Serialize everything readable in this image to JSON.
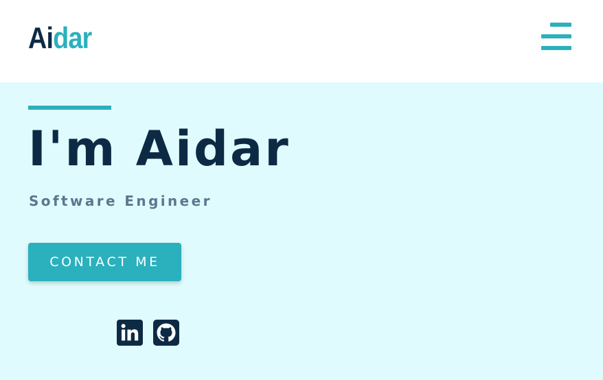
{
  "header": {
    "logo_dark": "Ai",
    "logo_accent": "dar",
    "menu_icon": "hamburger-menu-icon"
  },
  "hero": {
    "title": "I'm Aidar",
    "subtitle": "Software Engineer",
    "contact_label": "CONTACT ME"
  },
  "social": [
    {
      "icon": "linkedin-icon"
    },
    {
      "icon": "github-icon"
    }
  ],
  "colors": {
    "accent": "#2bb0bd",
    "dark": "#0d2a45",
    "muted": "#5b7790",
    "hero_background": "#e0fbfd",
    "header_background": "#ffffff"
  }
}
